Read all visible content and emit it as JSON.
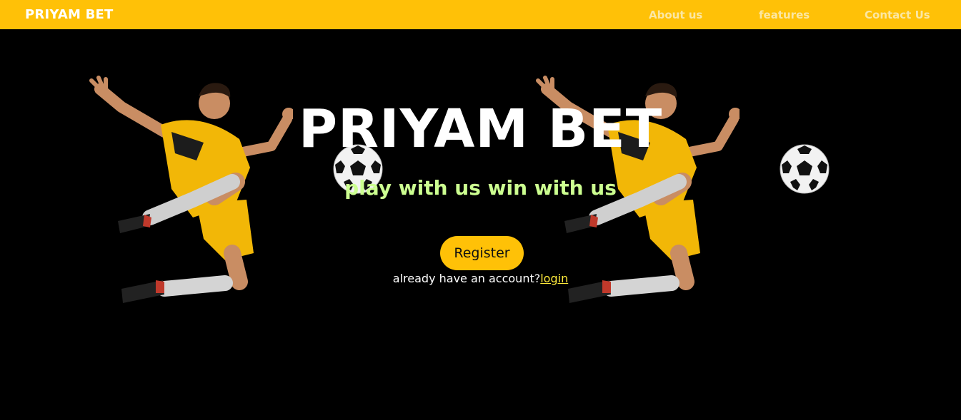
{
  "nav": {
    "brand": "PRIYAM BET",
    "links": [
      "About us",
      "features",
      "Contact Us"
    ]
  },
  "hero": {
    "title": "PRIYAM BET",
    "tagline": "play with us win with us",
    "register_label": "Register",
    "login_prompt": "already have an account?",
    "login_label": "login"
  },
  "colors": {
    "nav_background": "#ffc107",
    "page_background": "#000000",
    "tagline": "#ccff90",
    "button": "#ffc107",
    "login_link": "#ffeb3b"
  },
  "images": [
    "football-player-image",
    "soccer-ball-image"
  ]
}
